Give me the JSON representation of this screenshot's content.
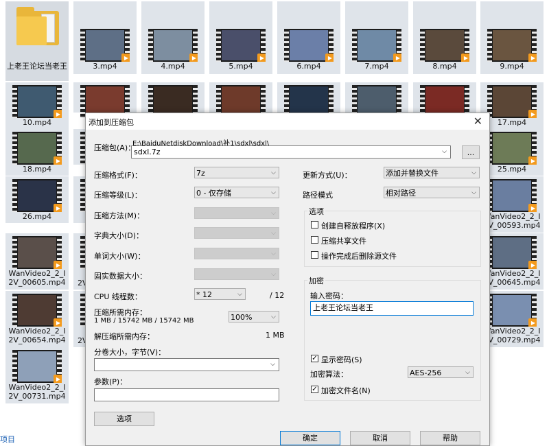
{
  "explorer": {
    "folder_label": "上老王论坛当老王",
    "row1": [
      "3.mp4",
      "4.mp4",
      "5.mp4",
      "6.mp4",
      "7.mp4",
      "8.mp4",
      "9.mp4"
    ],
    "row2_first": "10.mp4",
    "row2_last": "17.mp4",
    "row3_first": "18.mp4",
    "row3_last": "25.mp4",
    "row4_first": "26.mp4",
    "row4_last": "WanVideo2_2_I2V_00593.mp4",
    "row5_first": "WanVideo2_2_I2V_00605.mp4",
    "row5_second_partial": "2V",
    "row5_last": "WanVideo2_2_I2V_00645.mp4",
    "row6_first": "WanVideo2_2_I2V_00654.mp4",
    "row6_second_partial": "2V",
    "row6_last": "WanVideo2_2_I2V_00729.mp4",
    "row7_first": "WanVideo2_2_I2V_00731.mp4",
    "status_partial": "项目"
  },
  "dialog": {
    "title": "添加到压缩包",
    "close_glyph": "✕",
    "archive_label": "压缩包(A)：",
    "archive_path": "E:\\BaiduNetdiskDownload\\补1\\sdxl\\sdxl\\",
    "archive_name": "sdxl.7z",
    "browse_label": "...",
    "format_label": "压缩格式(F)：",
    "format_value": "7z",
    "level_label": "压缩等级(L)：",
    "level_value": "0 - 仅存储",
    "method_label": "压缩方法(M)：",
    "dict_label": "字典大小(D)：",
    "word_label": "单词大小(W)：",
    "solid_label": "固实数据大小：",
    "cpu_label": "CPU 线程数：",
    "cpu_value": "* 12",
    "cpu_total": "/ 12",
    "mem_comp_label": "压缩所需内存：",
    "mem_comp_value": "1 MB / 15742 MB / 15742 MB",
    "mem_pct": "100%",
    "mem_decomp_label": "解压缩所需内存：",
    "mem_decomp_value": "1 MB",
    "split_label": "分卷大小，字节(V)：",
    "params_label": "参数(P)：",
    "options_button": "选项",
    "update_label": "更新方式(U)：",
    "update_value": "添加并替换文件",
    "path_label": "路径模式",
    "path_value": "相对路径",
    "options_group": "选项",
    "opt_sfx": "创建自释放程序(X)",
    "opt_shared": "压缩共享文件",
    "opt_delete": "操作完成后删除源文件",
    "encrypt_group": "加密",
    "password_label": "输入密码：",
    "password_value": "上老王论坛当老王",
    "show_password": "显示密码(S)",
    "enc_method_label": "加密算法：",
    "enc_method_value": "AES-256",
    "enc_names": "加密文件名(N)",
    "check_glyph": "✓",
    "arrow_glyph": "⌵",
    "ok": "确定",
    "cancel": "取消",
    "help": "帮助"
  }
}
